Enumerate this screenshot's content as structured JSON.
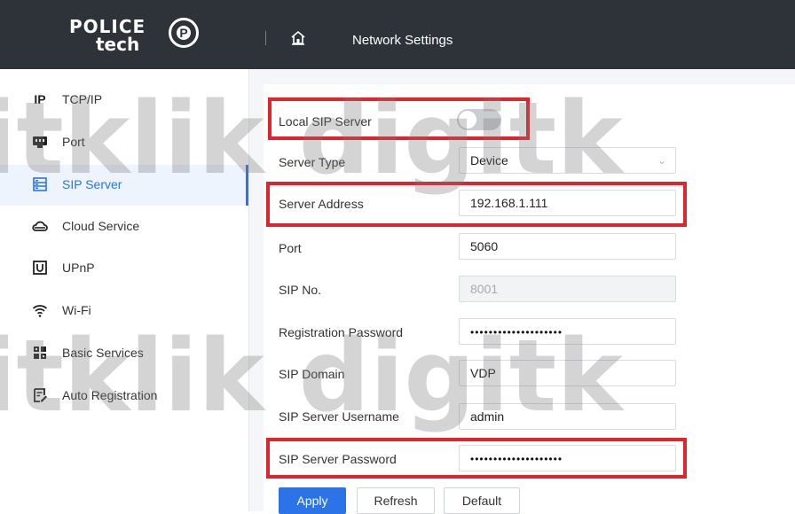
{
  "header": {
    "logo_line1": "POLICE",
    "logo_line2": "tech",
    "logo_letter": "P",
    "title": "Network Settings"
  },
  "sidebar": {
    "items": [
      {
        "label": "TCP/IP",
        "icon": "ip-icon",
        "active": false
      },
      {
        "label": "Port",
        "icon": "port-icon",
        "active": false
      },
      {
        "label": "SIP Server",
        "icon": "server-icon",
        "active": true
      },
      {
        "label": "Cloud Service",
        "icon": "cloud-icon",
        "active": false
      },
      {
        "label": "UPnP",
        "icon": "upnp-icon",
        "active": false
      },
      {
        "label": "Wi-Fi",
        "icon": "wifi-icon",
        "active": false
      },
      {
        "label": "Basic Services",
        "icon": "grid-icon",
        "active": false
      },
      {
        "label": "Auto Registration",
        "icon": "registration-icon",
        "active": false
      }
    ]
  },
  "form": {
    "local_sip_server": {
      "label": "Local SIP Server",
      "enabled": false
    },
    "server_type": {
      "label": "Server Type",
      "value": "Device"
    },
    "server_address": {
      "label": "Server Address",
      "value": "192.168.1.111"
    },
    "port": {
      "label": "Port",
      "value": "5060"
    },
    "sip_no": {
      "label": "SIP No.",
      "value": "8001"
    },
    "registration_password": {
      "label": "Registration Password",
      "value": "••••••••••••••••••••"
    },
    "sip_domain": {
      "label": "SIP Domain",
      "value": "VDP"
    },
    "sip_server_username": {
      "label": "SIP Server Username",
      "value": "admin"
    },
    "sip_server_password": {
      "label": "SIP Server Password",
      "value": "••••••••••••••••••••"
    }
  },
  "buttons": {
    "apply": "Apply",
    "refresh": "Refresh",
    "default": "Default"
  },
  "watermark": {
    "text": "itklik digitk"
  },
  "colors": {
    "header_bg": "#2d3339",
    "accent": "#2b73e6",
    "highlight_red": "#e1232b"
  }
}
